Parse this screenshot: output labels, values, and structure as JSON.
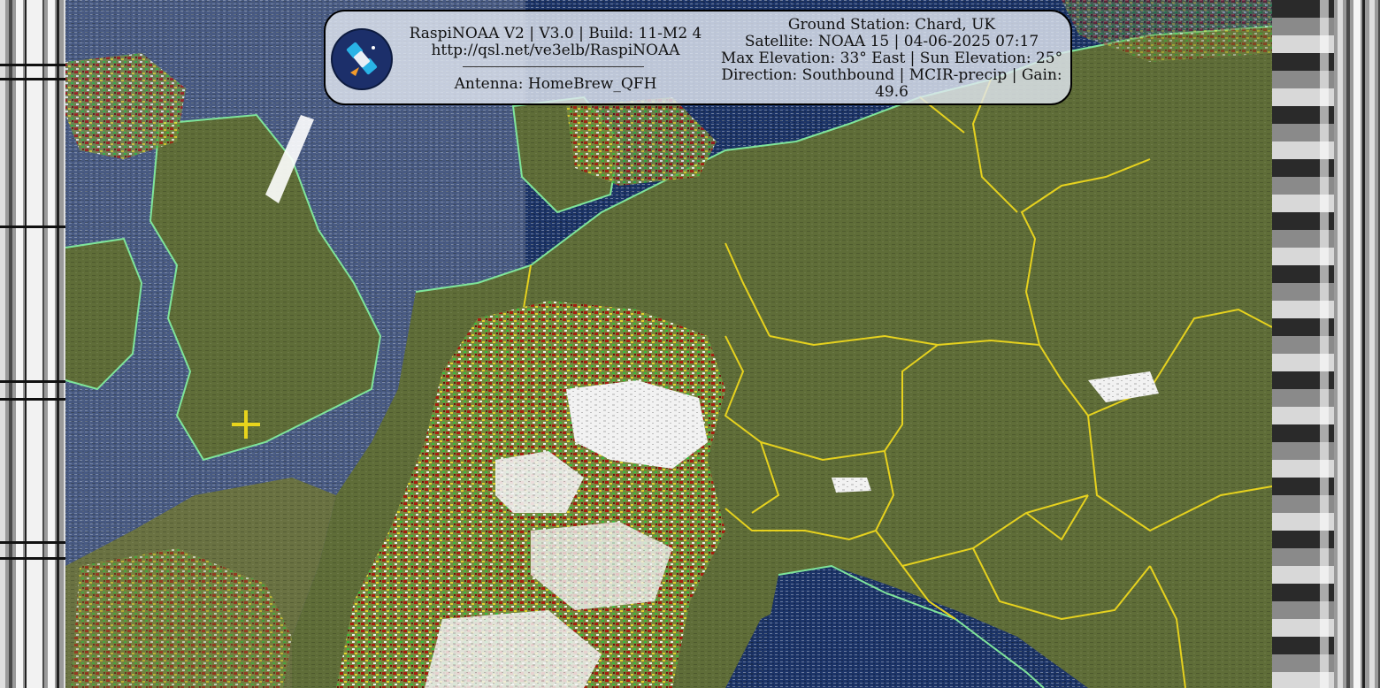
{
  "header": {
    "app_line": "RaspiNOAA V2 | V3.0 | Build: 11-M2 4",
    "url": "http://qsl.net/ve3elb/RaspiNOAA",
    "antenna": "Antenna: HomeBrew_QFH",
    "ground_station": "Ground Station: Chard, UK",
    "satellite": "Satellite: NOAA 15 | 04-06-2025 07:17",
    "elevation": "Max Elevation: 33° East | Sun Elevation: 25°",
    "direction": "Direction: Southbound | MCIR-precip | Gain:",
    "gain": "49.6"
  },
  "colors": {
    "sea": "#1c3468",
    "land": "#5f6d38",
    "border": "#e6d21e",
    "coast": "#7fe59a",
    "cloud": "#f4f4f4",
    "precip_red": "#b0140c",
    "precip_yellow": "#f0df2a",
    "station_marker": "#e8d41c"
  },
  "icons": {
    "logo": "satellite-icon",
    "marker": "plus-marker-icon"
  }
}
